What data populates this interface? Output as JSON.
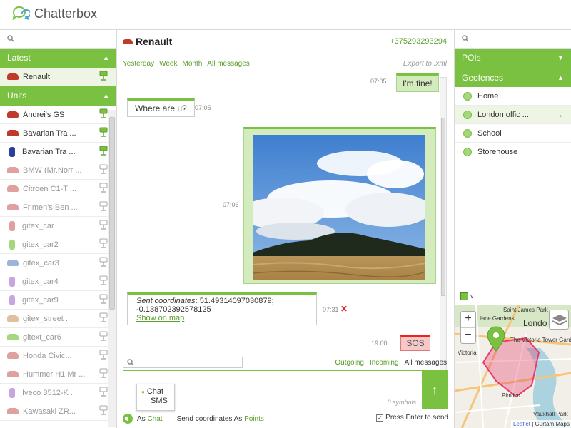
{
  "app": {
    "title": "Chatterbox"
  },
  "colors": {
    "accent": "#7ac142",
    "sos": "#e22222"
  },
  "left": {
    "search_placeholder": "",
    "latest_label": "Latest",
    "latest_items": [
      {
        "label": "Renault",
        "color": "#c0392b",
        "online": true
      }
    ],
    "units_label": "Units",
    "units": [
      {
        "label": "Andrei's GS",
        "color": "#c0392b",
        "online": true,
        "tall": false
      },
      {
        "label": "Bavarian Tra ...",
        "color": "#c0392b",
        "online": true,
        "tall": false
      },
      {
        "label": "Bavarian Tra ...",
        "color": "#2c3e9f",
        "online": true,
        "tall": true
      },
      {
        "label": "BMW (Mr.Norr ...",
        "color": "#e0a0a0",
        "online": false,
        "tall": false
      },
      {
        "label": "Citroen C1-T ...",
        "color": "#e0a0a0",
        "online": false,
        "tall": false
      },
      {
        "label": "Frimen's Ben ...",
        "color": "#e0a0a0",
        "online": false,
        "tall": false
      },
      {
        "label": "gitex_car",
        "color": "#e0a0a0",
        "online": false,
        "tall": true
      },
      {
        "label": "gitex_car2",
        "color": "#a6d77e",
        "online": false,
        "tall": true
      },
      {
        "label": "gitex_car3",
        "color": "#9fb3d9",
        "online": false,
        "tall": false
      },
      {
        "label": "gitex_car4",
        "color": "#c7a6e0",
        "online": false,
        "tall": true
      },
      {
        "label": "gitex_car9",
        "color": "#c7a6e0",
        "online": false,
        "tall": true
      },
      {
        "label": "gitex_street ...",
        "color": "#e0c0a0",
        "online": false,
        "tall": false
      },
      {
        "label": "gitext_car6",
        "color": "#a6d77e",
        "online": false,
        "tall": false
      },
      {
        "label": "Honda Civic...",
        "color": "#e0a0a0",
        "online": false,
        "tall": false
      },
      {
        "label": "Hummer H1 Mr ...",
        "color": "#e0a0a0",
        "online": false,
        "tall": false
      },
      {
        "label": "Iveco 3512-K ...",
        "color": "#c7a6e0",
        "online": false,
        "tall": true
      },
      {
        "label": "Kawasaki ZR...",
        "color": "#e0a0a0",
        "online": false,
        "tall": false
      }
    ]
  },
  "chat": {
    "unit_name": "Renault",
    "phone": "+375293293294",
    "filters": [
      "Yesterday",
      "Week",
      "Month",
      "All messages"
    ],
    "export_label": "Export to .xml",
    "messages": {
      "m1": {
        "text": "I'm fine!",
        "time": "07:05"
      },
      "m2": {
        "text": "Where are u?",
        "time": "07:05"
      },
      "m3": {
        "time": "07:06"
      },
      "m4": {
        "label": "Sent coordinates",
        "coords": "51.49314097030879; -0.138702392578125",
        "link": "Show on map",
        "time": "07:31"
      },
      "m5": {
        "text": "SOS",
        "time": "19:00"
      }
    },
    "direction_filters": [
      "Outgoing",
      "Incoming",
      "All messages"
    ],
    "message_search_placeholder": "",
    "composer": {
      "symbols": "0 symbols",
      "type_options": [
        "Chat",
        "SMS"
      ],
      "selected_type": "Chat"
    },
    "bottom": {
      "as_label": "As",
      "as_value": "Chat",
      "send_coords": "Send coordinates As",
      "send_coords_value": "Points",
      "press_enter": "Press Enter to send",
      "press_enter_checked": true
    }
  },
  "right": {
    "search_placeholder": "",
    "pois_label": "POIs",
    "geofences_label": "Geofences",
    "geofences": [
      {
        "label": "Home",
        "selected": false
      },
      {
        "label": "London offic ...",
        "selected": true
      },
      {
        "label": "School",
        "selected": false
      },
      {
        "label": "Storehouse",
        "selected": false
      }
    ],
    "map": {
      "labels": {
        "saint_james": "Saint James Park",
        "palace_gardens": "lace Gardens",
        "london": "Londo",
        "victoria_tower": "The Victoria Tower Garde",
        "victoria": "Victoria",
        "pimlico": "Pimlico",
        "vauxhall": "Vauxhall Park"
      },
      "attribution_link": "Leaflet",
      "attribution_text": "| Gurtam Maps"
    }
  }
}
